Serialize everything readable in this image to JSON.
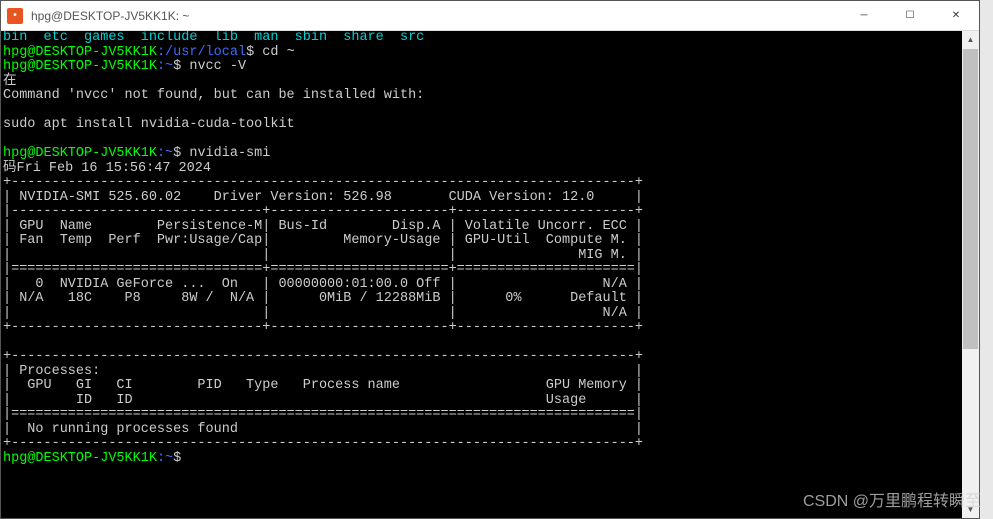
{
  "window": {
    "title": "hpg@DESKTOP-JV5KK1K: ~",
    "icon_char": "•"
  },
  "win_controls": {
    "minimize": "─",
    "maximize": "☐",
    "close": "✕"
  },
  "terminal": {
    "ls_output": "bin  etc  games  include  lib  man  sbin  share  src",
    "prompts": {
      "p1_user": "hpg@DESKTOP-JV5KK1K",
      "p1_path": ":/usr/local",
      "p1_dollar": "$ ",
      "p1_cmd": "cd ~",
      "p2_user": "hpg@DESKTOP-JV5KK1K",
      "p2_path": ":~",
      "p2_dollar": "$ ",
      "p2_cmd": "nvcc -V",
      "p3_user": "hpg@DESKTOP-JV5KK1K",
      "p3_path": ":~",
      "p3_dollar": "$ ",
      "p3_cmd": "nvidia-smi",
      "p4_user": "hpg@DESKTOP-JV5KK1K",
      "p4_path": ":~",
      "p4_dollar": "$ "
    },
    "nvcc_error": {
      "left_char1": "在",
      "line1": "Command 'nvcc' not found, but can be installed with:",
      "blank": "",
      "line2": "sudo apt install nvidia-cuda-toolkit"
    },
    "smi": {
      "left_char2": "码",
      "date": "Fri Feb 16 15:56:47 2024",
      "border_top": "+-----------------------------------------------------------------------------+",
      "header1": "| NVIDIA-SMI 525.60.02    Driver Version: 526.98       CUDA Version: 12.0     |",
      "sep1": "|-------------------------------+----------------------+----------------------+",
      "hdr_a": "| GPU  Name        Persistence-M| Bus-Id        Disp.A | Volatile Uncorr. ECC |",
      "hdr_b": "| Fan  Temp  Perf  Pwr:Usage/Cap|         Memory-Usage | GPU-Util  Compute M. |",
      "hdr_c": "|                               |                      |               MIG M. |",
      "sep2": "|===============================+======================+======================|",
      "row_a": "|   0  NVIDIA GeForce ...  On   | 00000000:01:00.0 Off |                  N/A |",
      "row_b": "| N/A   18C    P8     8W /  N/A |      0MiB / 12288MiB |      0%      Default |",
      "row_c": "|                               |                      |                  N/A |",
      "border_bot": "+-------------------------------+----------------------+----------------------+",
      "blank2": "",
      "proc_top": "+-----------------------------------------------------------------------------+",
      "proc_hdr": "| Processes:                                                                  |",
      "proc_a": "|  GPU   GI   CI        PID   Type   Process name                  GPU Memory |",
      "proc_b": "|        ID   ID                                                   Usage      |",
      "proc_sep": "|=============================================================================|",
      "proc_none": "|  No running processes found                                                 |",
      "proc_bot": "+-----------------------------------------------------------------------------+"
    }
  },
  "watermark": "CSDN @万里鹏程转瞬至"
}
